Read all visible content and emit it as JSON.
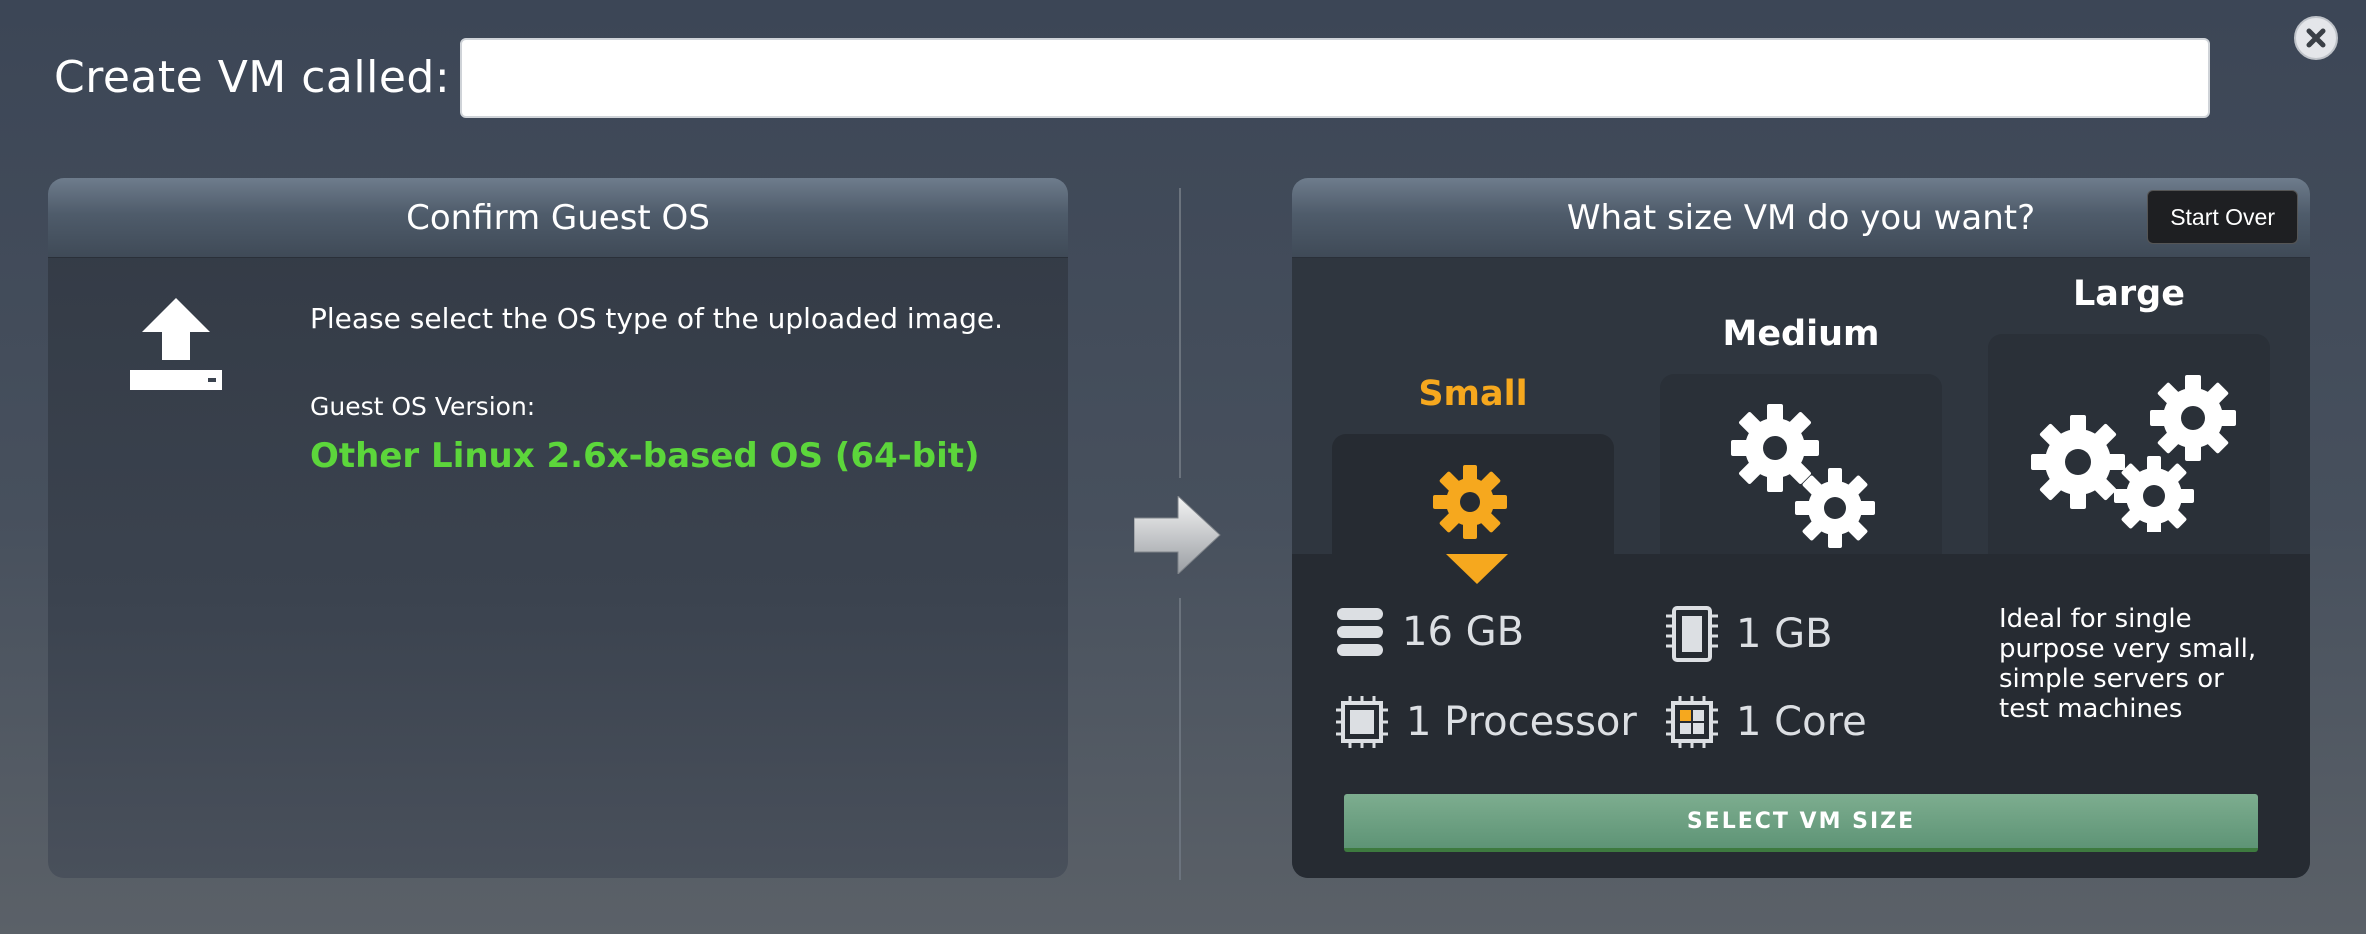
{
  "dialog": {
    "name_label": "Create VM called:",
    "name_value": "",
    "name_placeholder": "",
    "close_icon": "close-icon"
  },
  "left_panel": {
    "title": "Confirm Guest OS",
    "icon": "upload-icon",
    "prompt": "Please select the OS type of the uploaded image.",
    "version_label": "Guest OS Version:",
    "version_value": "Other Linux 2.6x-based OS (64-bit)",
    "version_color": "#5cd63b"
  },
  "divider": {
    "icon": "arrow-right-icon"
  },
  "right_panel": {
    "title": "What size VM do you want?",
    "start_over_label": "Start Over",
    "sizes": [
      {
        "label": "Small",
        "icon": "gear-icon",
        "selected": true,
        "color": "#f6a81e"
      },
      {
        "label": "Medium",
        "icon": "two-gears-icon",
        "selected": false
      },
      {
        "label": "Large",
        "icon": "three-gears-icon",
        "selected": false
      }
    ],
    "specs": {
      "storage": "16 GB",
      "memory": "1 GB",
      "processors": "1 Processor",
      "cores": "1 Core"
    },
    "description": "Ideal for single purpose very small, simple servers or test machines",
    "select_label": "SELECT VM SIZE"
  }
}
